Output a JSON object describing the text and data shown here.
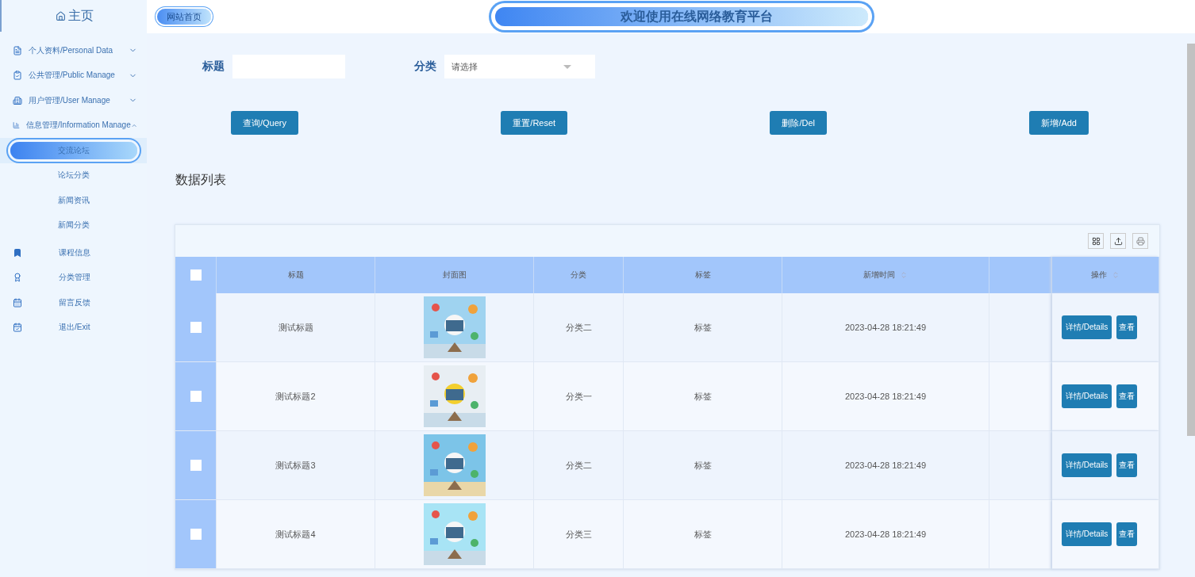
{
  "sidebar": {
    "home": "主页",
    "menus": [
      {
        "label": "个人资料/Personal Data",
        "expanded": false
      },
      {
        "label": "公共管理/Public Manage",
        "expanded": false
      },
      {
        "label": "用户管理/User Manage",
        "expanded": false
      },
      {
        "label": "信息管理/Information Manage",
        "expanded": true,
        "children": [
          {
            "label": "交流论坛",
            "selected": true
          },
          {
            "label": "论坛分类",
            "selected": false
          },
          {
            "label": "新闻资讯",
            "selected": false
          },
          {
            "label": "新闻分类",
            "selected": false
          }
        ]
      }
    ],
    "links": [
      {
        "label": "课程信息",
        "kind": "bookmark"
      },
      {
        "label": "分类管理",
        "kind": "award"
      },
      {
        "label": "留言反馈",
        "kind": "calendar"
      },
      {
        "label": "退出/Exit",
        "kind": "exit"
      }
    ]
  },
  "header": {
    "site_link": "网站首页",
    "banner": "欢迎使用在线网络教育平台"
  },
  "filters": [
    {
      "label": "标题",
      "kind": "input"
    },
    {
      "label": "分类",
      "kind": "select",
      "placeholder": "请选择"
    }
  ],
  "actions": [
    "查询/Query",
    "重置/Reset",
    "删除/Del",
    "新增/Add"
  ],
  "list_title": "数据列表",
  "table": {
    "columns": [
      {
        "label": "标题",
        "sortable": false
      },
      {
        "label": "封面图",
        "sortable": false
      },
      {
        "label": "分类",
        "sortable": false
      },
      {
        "label": "标签",
        "sortable": false
      },
      {
        "label": "新增时间",
        "sortable": true
      },
      {
        "sortable": false
      }
    ],
    "all_checked": false,
    "action_column": {
      "label": "操作",
      "sortable": true
    },
    "rows": [
      {
        "checked": false,
        "title": "测试标题",
        "category": "分类二",
        "tag": "标签",
        "time": "2023-04-28 18:21:49",
        "buttons": [
          "详情/Details",
          "查看"
        ]
      },
      {
        "checked": false,
        "title": "测试标题2",
        "category": "分类一",
        "tag": "标签",
        "time": "2023-04-28 18:21:49",
        "buttons": [
          "详情/Details",
          "查看"
        ]
      },
      {
        "checked": false,
        "title": "测试标题3",
        "category": "分类二",
        "tag": "标签",
        "time": "2023-04-28 18:21:49",
        "buttons": [
          "详情/Details",
          "查看"
        ]
      },
      {
        "checked": false,
        "title": "测试标题4",
        "category": "分类三",
        "tag": "标签",
        "time": "2023-04-28 18:21:49",
        "buttons": [
          "详情/Details",
          "查看"
        ]
      }
    ]
  }
}
